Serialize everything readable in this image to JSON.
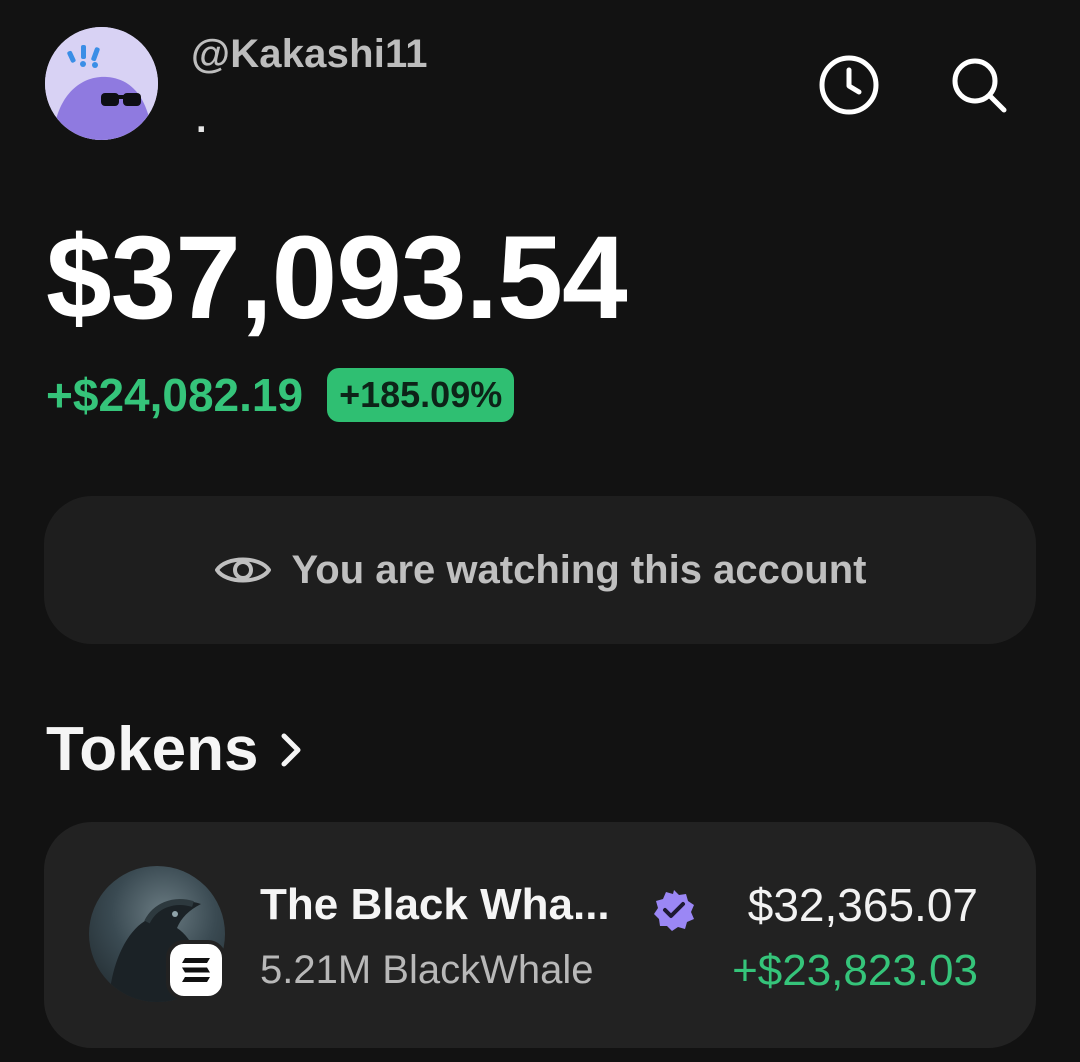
{
  "profile": {
    "username": "@Kakashi11",
    "subname": ".",
    "avatar_icon": "cool-cat-sunglasses-avatar"
  },
  "header": {
    "history_icon": "clock-icon",
    "search_icon": "search-icon"
  },
  "balance": {
    "total": "$37,093.54",
    "change_value": "+$24,082.19",
    "change_percent": "+185.09%",
    "positive_color": "#35c47a"
  },
  "watch_banner": {
    "icon": "eye-icon",
    "text": "You are watching this account"
  },
  "tokens": {
    "title": "Tokens",
    "items": [
      {
        "name": "The Black Wha...",
        "verified_icon": "verified-badge-icon",
        "amount": "5.21M BlackWhale",
        "value": "$32,365.07",
        "change": "+$23,823.03",
        "chain_icon": "solana-icon"
      }
    ]
  }
}
